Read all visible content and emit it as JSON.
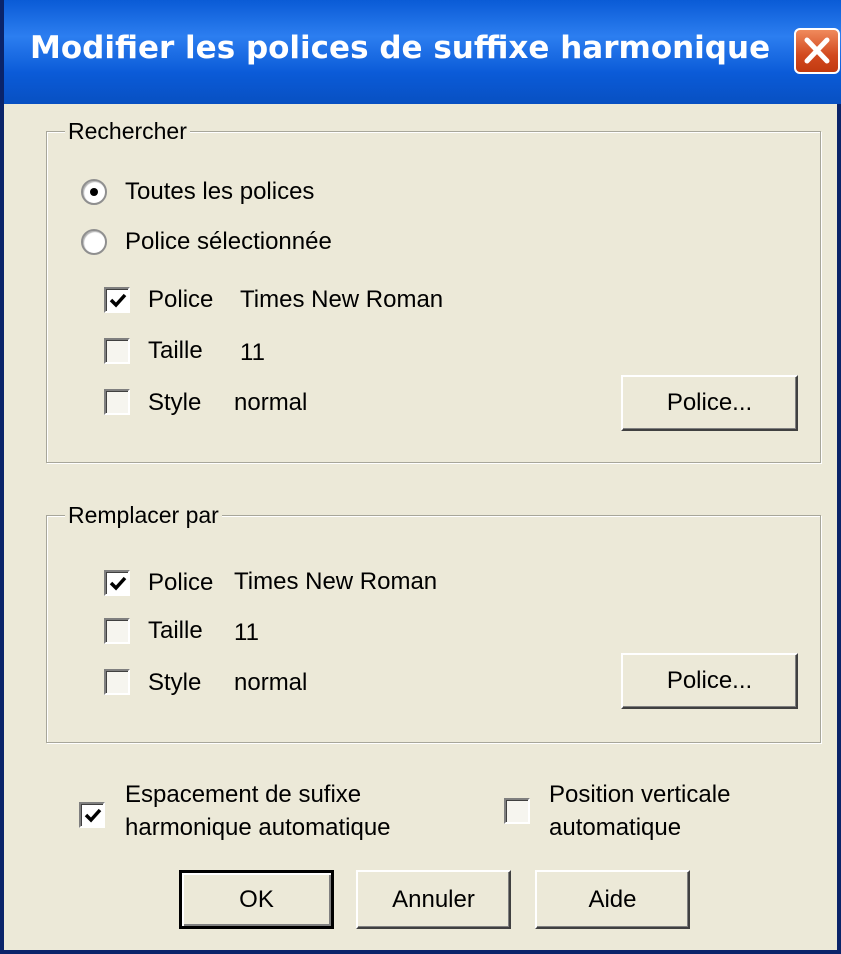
{
  "window": {
    "title": "Modifier les polices de suffixe harmonique"
  },
  "search": {
    "group_label": "Rechercher",
    "radio_all": {
      "label": "Toutes les polices",
      "selected": true
    },
    "radio_selected": {
      "label": "Police sélectionnée",
      "selected": false
    },
    "font": {
      "label": "Police",
      "value": "Times New Roman",
      "checked": true
    },
    "size": {
      "label": "Taille",
      "value": "11",
      "checked": false
    },
    "style": {
      "label": "Style",
      "value": "normal",
      "checked": false
    },
    "font_button": "Police..."
  },
  "replace": {
    "group_label": "Remplacer par",
    "font": {
      "label": "Police",
      "value": "Times New Roman",
      "checked": true
    },
    "size": {
      "label": "Taille",
      "value": "11",
      "checked": false
    },
    "style": {
      "label": "Style",
      "value": "normal",
      "checked": false
    },
    "font_button": "Police..."
  },
  "options": {
    "spacing": {
      "line1": "Espacement de sufixe",
      "line2": "harmonique automatique",
      "checked": true
    },
    "vertical": {
      "line1": "Position verticale",
      "line2": "automatique",
      "checked": false
    }
  },
  "buttons": {
    "ok": "OK",
    "cancel": "Annuler",
    "help": "Aide"
  }
}
